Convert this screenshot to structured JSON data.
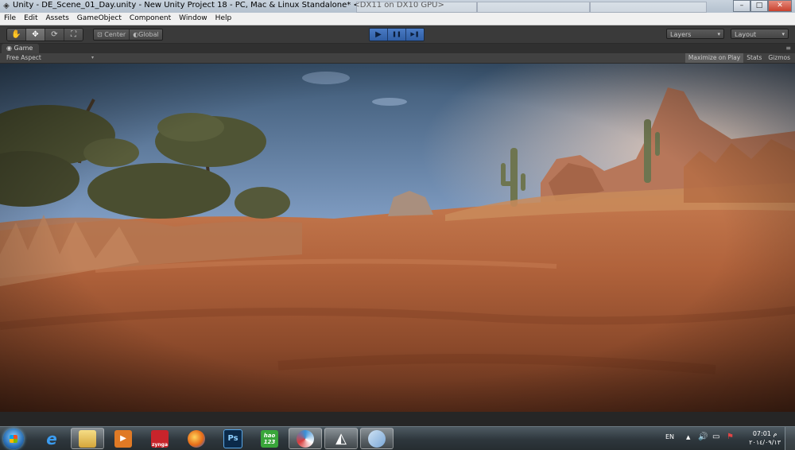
{
  "window": {
    "title": "Unity - DE_Scene_01_Day.unity - New Unity Project 18 - PC, Mac & Linux Standalone* <DX11 on DX10 GPU>",
    "minimize": "–",
    "maximize": "□",
    "close": "✕"
  },
  "menu": [
    "File",
    "Edit",
    "Assets",
    "GameObject",
    "Component",
    "Window",
    "Help"
  ],
  "toolbar": {
    "tools": [
      "✋",
      "✥",
      "⟳",
      "⛶"
    ],
    "pivot_center": "Center",
    "pivot_global": "Global",
    "play": "▶",
    "pause": "❚❚",
    "step": "▶❚",
    "layers": "Layers",
    "layout": "Layout"
  },
  "game_panel": {
    "tab": "Game",
    "aspect": "Free Aspect",
    "maximize_on_play": "Maximize on Play",
    "stats": "Stats",
    "gizmos": "Gizmos"
  },
  "taskbar": {
    "apps": [
      {
        "name": "internet-explorer",
        "label": "e",
        "color": "#1f7fd6"
      },
      {
        "name": "file-explorer",
        "label": "",
        "color": "#e8c25a"
      },
      {
        "name": "media-player",
        "label": "▶",
        "color": "#e87a22"
      },
      {
        "name": "zynga",
        "label": "zynga",
        "color": "#c8242b"
      },
      {
        "name": "firefox",
        "label": "",
        "color": "#e66a16"
      },
      {
        "name": "photoshop",
        "label": "Ps",
        "color": "#0b2a4a"
      },
      {
        "name": "hao123",
        "label": "hao 123",
        "color": "#39a63a"
      },
      {
        "name": "browser",
        "label": "",
        "color": "#3a8fd6"
      },
      {
        "name": "unity",
        "label": "",
        "color": "#2a2a2a"
      },
      {
        "name": "paint",
        "label": "",
        "color": "#8ab6e0"
      }
    ],
    "language": "EN",
    "time": "07:01 م",
    "date": "٢٠١٤/٠٩/١٣"
  }
}
